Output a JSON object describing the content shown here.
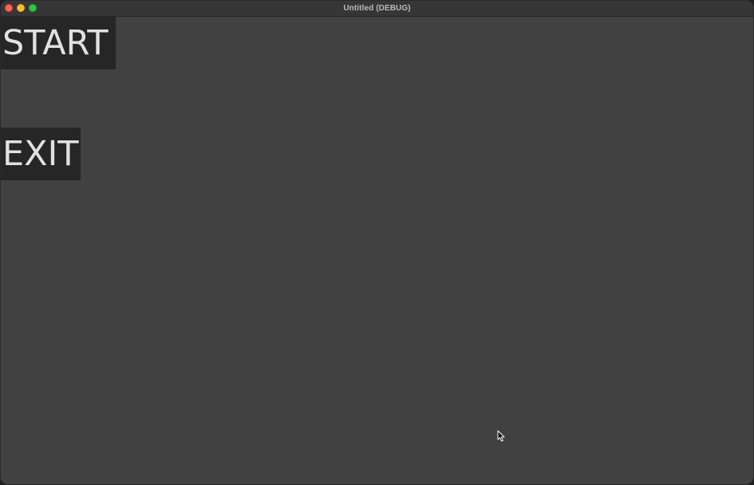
{
  "window": {
    "title": "Untitled (DEBUG)",
    "controls": {
      "close_color": "#fe5f57",
      "minimize_color": "#febc2e",
      "zoom_color": "#28c840"
    }
  },
  "menu": {
    "start_label": "START",
    "exit_label": "EXIT"
  },
  "colors": {
    "background": "#414141",
    "button_background": "#262626",
    "button_text": "#e1e1e1"
  },
  "icons": {
    "cursor": "arrow-pointer-icon"
  }
}
